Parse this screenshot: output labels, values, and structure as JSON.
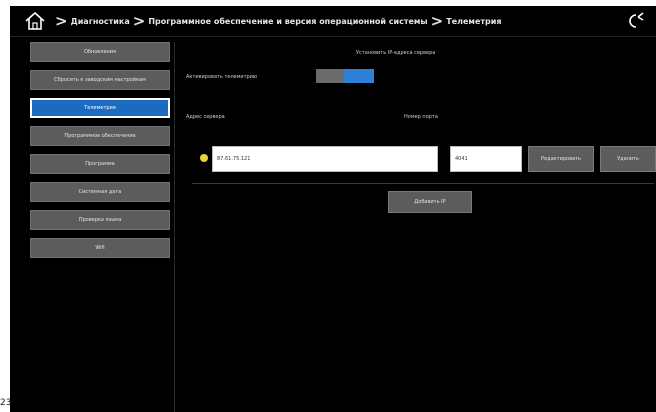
{
  "topbar": {
    "breadcrumb": [
      "Диагностика",
      "Программное обеспечение и версия операционной системы",
      "Телеметрия"
    ]
  },
  "sidebar": {
    "items": [
      {
        "label": "Обновления",
        "active": false
      },
      {
        "label": "Сбросить к заводским настройкам",
        "active": false
      },
      {
        "label": "Телеметрия",
        "active": true
      },
      {
        "label": "Программное обеспечение",
        "active": false
      },
      {
        "label": "Программа",
        "active": false
      },
      {
        "label": "Системная дата",
        "active": false
      },
      {
        "label": "Проверка языка",
        "active": false
      },
      {
        "label": "Wifi",
        "active": false
      }
    ]
  },
  "main": {
    "header": "Установить IP-адреса сервера",
    "toggle_label": "Активировать телеметрию",
    "toggle_on": true,
    "address_label": "Адрес сервера",
    "port_label": "Номер порта",
    "address_value": "87.61.75.121",
    "port_value": "4041",
    "edit_button": "Редактировать",
    "delete_button": "Удалить",
    "add_button": "Добавить IP"
  },
  "corner_text": "23",
  "colors": {
    "accent": "#1d6bc0",
    "status": "#e6d43a"
  }
}
